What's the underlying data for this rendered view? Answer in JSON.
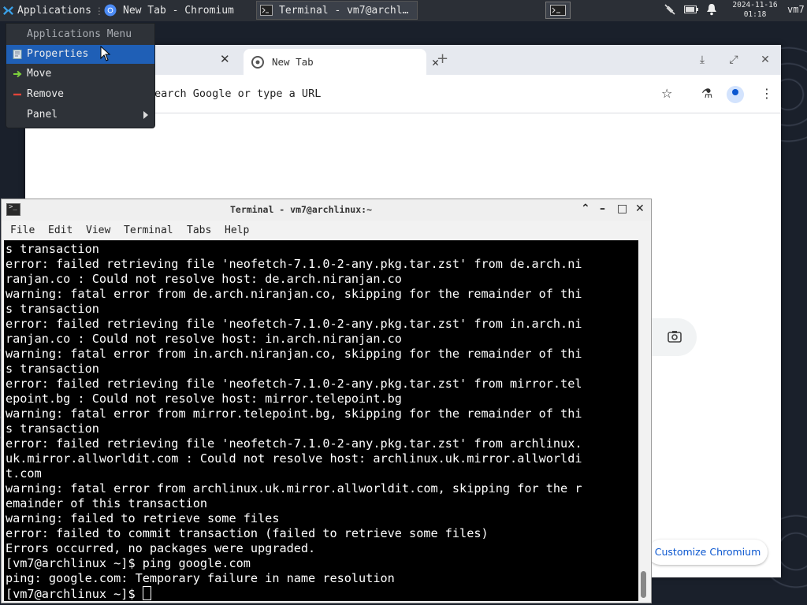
{
  "panel": {
    "apps_label": "Applications",
    "tasks": [
      {
        "label": "New Tab - Chromium"
      },
      {
        "label": "Terminal - vm7@archl…"
      }
    ],
    "clock_date": "2024-11-16",
    "clock_time": "01:18",
    "user": "vm7"
  },
  "menu": {
    "header": "Applications Menu",
    "items": [
      {
        "label": "Properties"
      },
      {
        "label": "Move"
      },
      {
        "label": "Remove"
      },
      {
        "label": "Panel"
      }
    ]
  },
  "chrome": {
    "tab_title": "New Tab",
    "omnibox_text": "earch Google or type a URL",
    "customize_label": "Customize Chromium"
  },
  "terminal": {
    "title": "Terminal - vm7@archlinux:~",
    "menu": [
      "File",
      "Edit",
      "View",
      "Terminal",
      "Tabs",
      "Help"
    ],
    "lines": [
      "s transaction",
      "error: failed retrieving file 'neofetch-7.1.0-2-any.pkg.tar.zst' from de.arch.ni",
      "ranjan.co : Could not resolve host: de.arch.niranjan.co",
      "warning: fatal error from de.arch.niranjan.co, skipping for the remainder of thi",
      "s transaction",
      "error: failed retrieving file 'neofetch-7.1.0-2-any.pkg.tar.zst' from in.arch.ni",
      "ranjan.co : Could not resolve host: in.arch.niranjan.co",
      "warning: fatal error from in.arch.niranjan.co, skipping for the remainder of thi",
      "s transaction",
      "error: failed retrieving file 'neofetch-7.1.0-2-any.pkg.tar.zst' from mirror.tel",
      "epoint.bg : Could not resolve host: mirror.telepoint.bg",
      "warning: fatal error from mirror.telepoint.bg, skipping for the remainder of thi",
      "s transaction",
      "error: failed retrieving file 'neofetch-7.1.0-2-any.pkg.tar.zst' from archlinux.",
      "uk.mirror.allworldit.com : Could not resolve host: archlinux.uk.mirror.allworldi",
      "t.com",
      "warning: fatal error from archlinux.uk.mirror.allworldit.com, skipping for the r",
      "emainder of this transaction",
      "warning: failed to retrieve some files",
      "error: failed to commit transaction (failed to retrieve some files)",
      "Errors occurred, no packages were upgraded.",
      "[vm7@archlinux ~]$ ping google.com",
      "ping: google.com: Temporary failure in name resolution"
    ],
    "prompt": "[vm7@archlinux ~]$ "
  }
}
